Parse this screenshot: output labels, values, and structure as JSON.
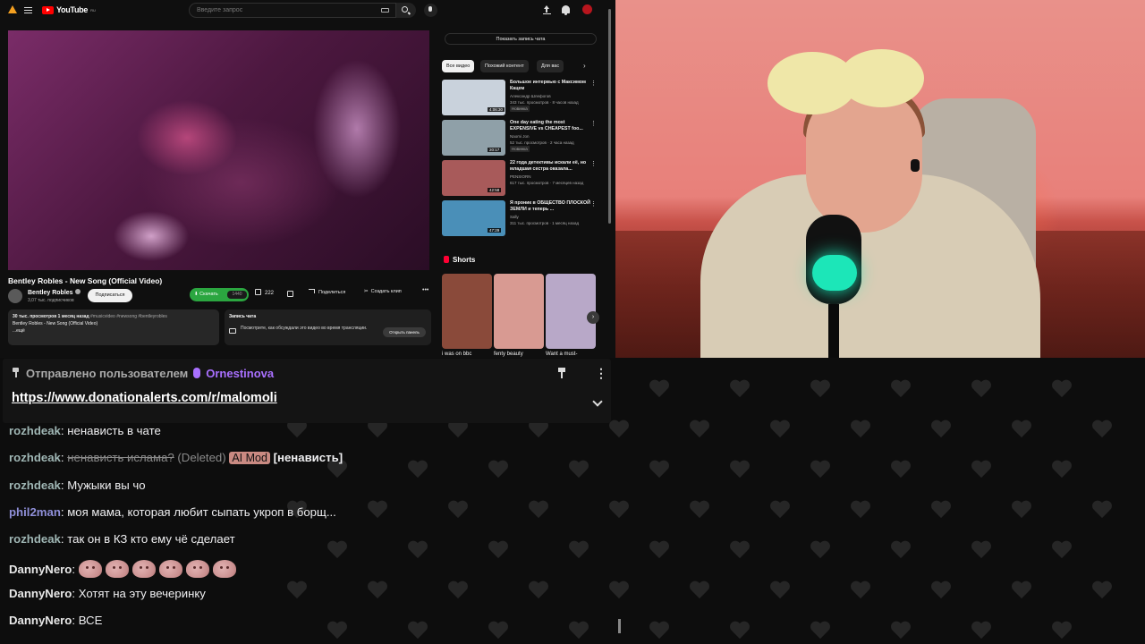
{
  "youtube": {
    "logo_text": "YouTube",
    "logo_sup": "RU",
    "search_placeholder": "Введите запрос",
    "video": {
      "title": "Bentley Robles - New Song (Official Video)",
      "channel": "Bentley Robles",
      "subscribers": "3,07 тыс. подписчиков",
      "subscribe_label": "Подписаться",
      "download_label": "Скачать",
      "quality": "1440",
      "likes": "222",
      "share_label": "Поделиться",
      "clip_label": "Создать клип",
      "description": {
        "views_line": "30 тыс. просмотров  1 месяц назад",
        "tags": "#musicvideo #newsong #bentleyrobles",
        "text": "Bentley Robles - New Song (Official Video)",
        "more": "...ещё"
      },
      "live_chat": {
        "title": "Запись чата",
        "hint": "Посмотрите, как обсуждали это видео во время трансляции.",
        "open_label": "Открыть панель"
      }
    },
    "sidebar": {
      "show_chat_label": "Показать запись чата",
      "chips": [
        "Все видео",
        "Похожий контент",
        "Для вас"
      ],
      "recommendations": [
        {
          "title": "Большое интервью с Максимом Кацем",
          "channel": "Александр Шлефогов",
          "meta": "343 тыс. просмотров · 8 часов назад",
          "badge": "Новинка",
          "duration": "4:06:30",
          "thumb_color": "#c9d2dc"
        },
        {
          "title": "One day eating the most EXPENSIVE vs CHEAPEST foo...",
          "channel": "Naomi Jon",
          "meta": "52 тыс. просмотров · 2 часа назад",
          "badge": "Новинка",
          "duration": "20:17",
          "thumb_color": "#8fa0a8"
        },
        {
          "title": "22 года детективы искали её, но младшая сестра оказала...",
          "channel": "PENSIORN",
          "meta": "617 тыс. просмотров · 7 месяцев назад",
          "badge": "",
          "duration": "42:58",
          "thumb_color": "#a85a5a"
        },
        {
          "title": "Я проник в ОБЩЕСТВО ПЛОСКОЙ ЗЕМЛИ и теперь ...",
          "channel": "Sally",
          "meta": "311 тыс. просмотров · 1 месяц назад",
          "badge": "",
          "duration": "47:29",
          "thumb_color": "#4a8fb8"
        }
      ],
      "shorts_title": "Shorts",
      "shorts": [
        {
          "label": "i was on bbc",
          "color": "#8a4a3a"
        },
        {
          "label": "fenty beauty",
          "color": "#d89a92"
        },
        {
          "label": "Want a must-",
          "color": "#b8a8c8"
        }
      ]
    }
  },
  "pinned": {
    "prefix": "Отправлено пользователем",
    "user": "Ornestinova",
    "link": "https://www.donationalerts.com/r/malomoli",
    "user_color": "#a970ff"
  },
  "chat": {
    "messages": [
      {
        "user": "rozhdeak",
        "color": "#9fb6b4",
        "text": "ненависть в чате"
      },
      {
        "user": "rozhdeak",
        "color": "#9fb6b4",
        "deleted_text": "ненависть ислама?",
        "deleted_tag": "(Deleted)",
        "badge": "AI Mod",
        "reason": "[ненависть]"
      },
      {
        "user": "rozhdeak",
        "color": "#9fb6b4",
        "text": "Мужыки вы чо"
      },
      {
        "user": "phil2man",
        "color": "#8f8fd8",
        "text": "моя мама, которая любит сыпать укроп в борщ..."
      },
      {
        "user": "rozhdeak",
        "color": "#9fb6b4",
        "text": "так он в КЗ кто ему чё сделает"
      },
      {
        "user": "DannyNero",
        "color": "#e8e8e8",
        "emote_count": 6
      },
      {
        "user": "DannyNero",
        "color": "#e8e8e8",
        "text": "Хотят на эту вечеринку"
      },
      {
        "user": "DannyNero",
        "color": "#e8e8e8",
        "text": "ВСЕ"
      }
    ]
  }
}
